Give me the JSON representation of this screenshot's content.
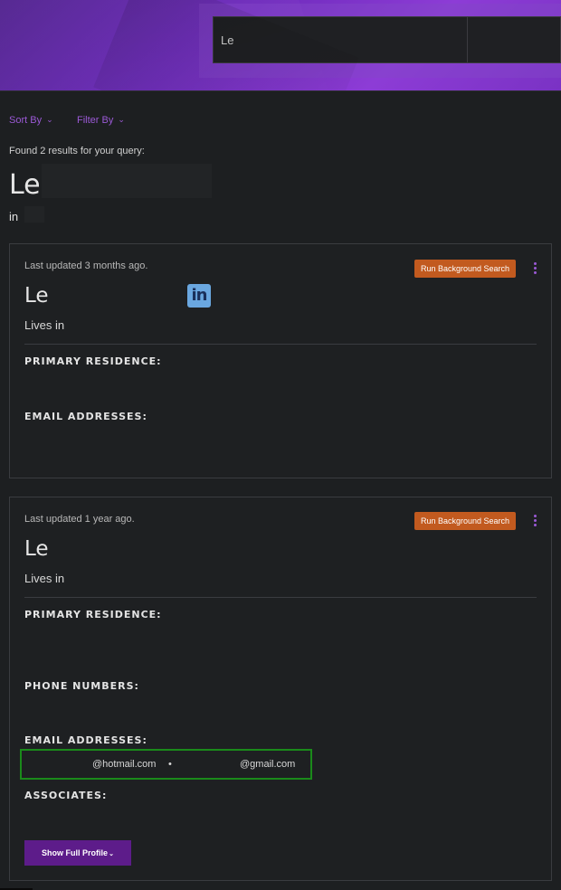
{
  "header": {
    "search_value": "Le"
  },
  "controls": {
    "sort_label": "Sort By",
    "filter_label": "Filter By",
    "chevron": "⌄"
  },
  "results": {
    "found_text": "Found 2 results for your query:",
    "query_name": "Le",
    "query_location": "in"
  },
  "cards": [
    {
      "updated": "Last updated 3 months ago.",
      "run_bg_label": "Run Background Search",
      "name": "Le",
      "lives": "Lives in",
      "has_linkedin": true,
      "linkedin_label": "in",
      "sections": [
        "PRIMARY RESIDENCE:",
        "EMAIL ADDRESSES:"
      ]
    },
    {
      "updated": "Last updated 1 year ago.",
      "run_bg_label": "Run Background Search",
      "name": "Le",
      "lives": "Lives in",
      "sections": [
        "PRIMARY RESIDENCE:",
        "PHONE NUMBERS:",
        "EMAIL ADDRESSES:",
        "ASSOCIATES:"
      ],
      "emails": [
        "@hotmail.com",
        "@gmail.com"
      ],
      "email_separator": "•",
      "show_full_label": "Show Full Profile",
      "show_full_chevron": "⌄"
    }
  ],
  "colors": {
    "accent": "#9b59d6",
    "button_orange": "#c25a1f",
    "button_purple": "#5d1c8a",
    "highlight_green": "#1a8a1a",
    "linkedin_blue": "#6aa7e0"
  }
}
